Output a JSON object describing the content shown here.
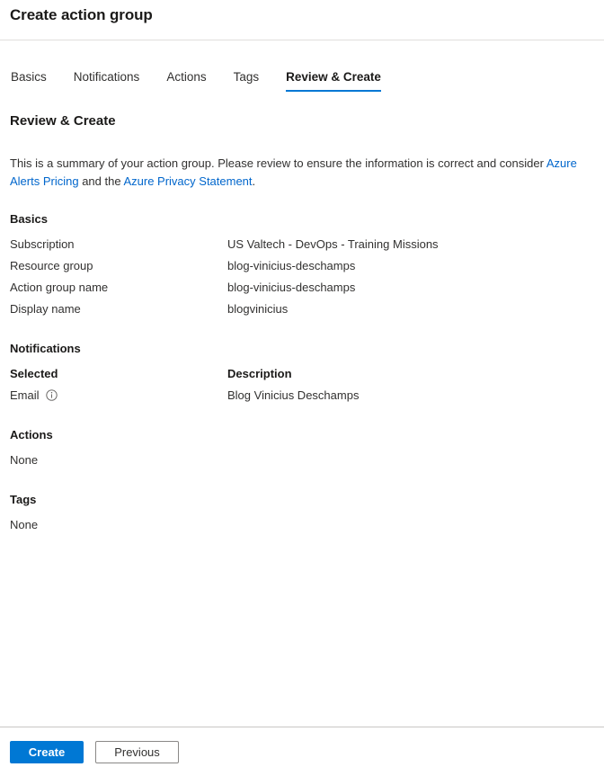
{
  "header": {
    "title": "Create action group"
  },
  "tabs": [
    {
      "label": "Basics",
      "active": false
    },
    {
      "label": "Notifications",
      "active": false
    },
    {
      "label": "Actions",
      "active": false
    },
    {
      "label": "Tags",
      "active": false
    },
    {
      "label": "Review & Create",
      "active": true
    }
  ],
  "page": {
    "heading": "Review & Create",
    "intro": {
      "part1": "This is a summary of your action group. Please review to ensure the information is correct and consider ",
      "link1": "Azure Alerts Pricing",
      "part2": " and the ",
      "link2": "Azure Privacy Statement",
      "part3": "."
    }
  },
  "basics": {
    "title": "Basics",
    "rows": [
      {
        "key": "Subscription",
        "value": "US Valtech - DevOps - Training Missions"
      },
      {
        "key": "Resource group",
        "value": "blog-vinicius-deschamps"
      },
      {
        "key": "Action group name",
        "value": "blog-vinicius-deschamps"
      },
      {
        "key": "Display name",
        "value": "blogvinicius"
      }
    ]
  },
  "notifications": {
    "title": "Notifications",
    "columns": {
      "selected": "Selected",
      "description": "Description"
    },
    "rows": [
      {
        "selected": "Email",
        "icon": "info-icon",
        "description": "Blog Vinicius Deschamps"
      }
    ]
  },
  "actions": {
    "title": "Actions",
    "empty": "None"
  },
  "tags": {
    "title": "Tags",
    "empty": "None"
  },
  "footer": {
    "create_label": "Create",
    "previous_label": "Previous"
  },
  "colors": {
    "accent": "#0078d4",
    "link": "#0066cc",
    "text": "#323130",
    "heading": "#1b1a19",
    "divider": "#e1dfdd",
    "footer_divider": "#c8c6c4",
    "button_border": "#8a8886"
  }
}
